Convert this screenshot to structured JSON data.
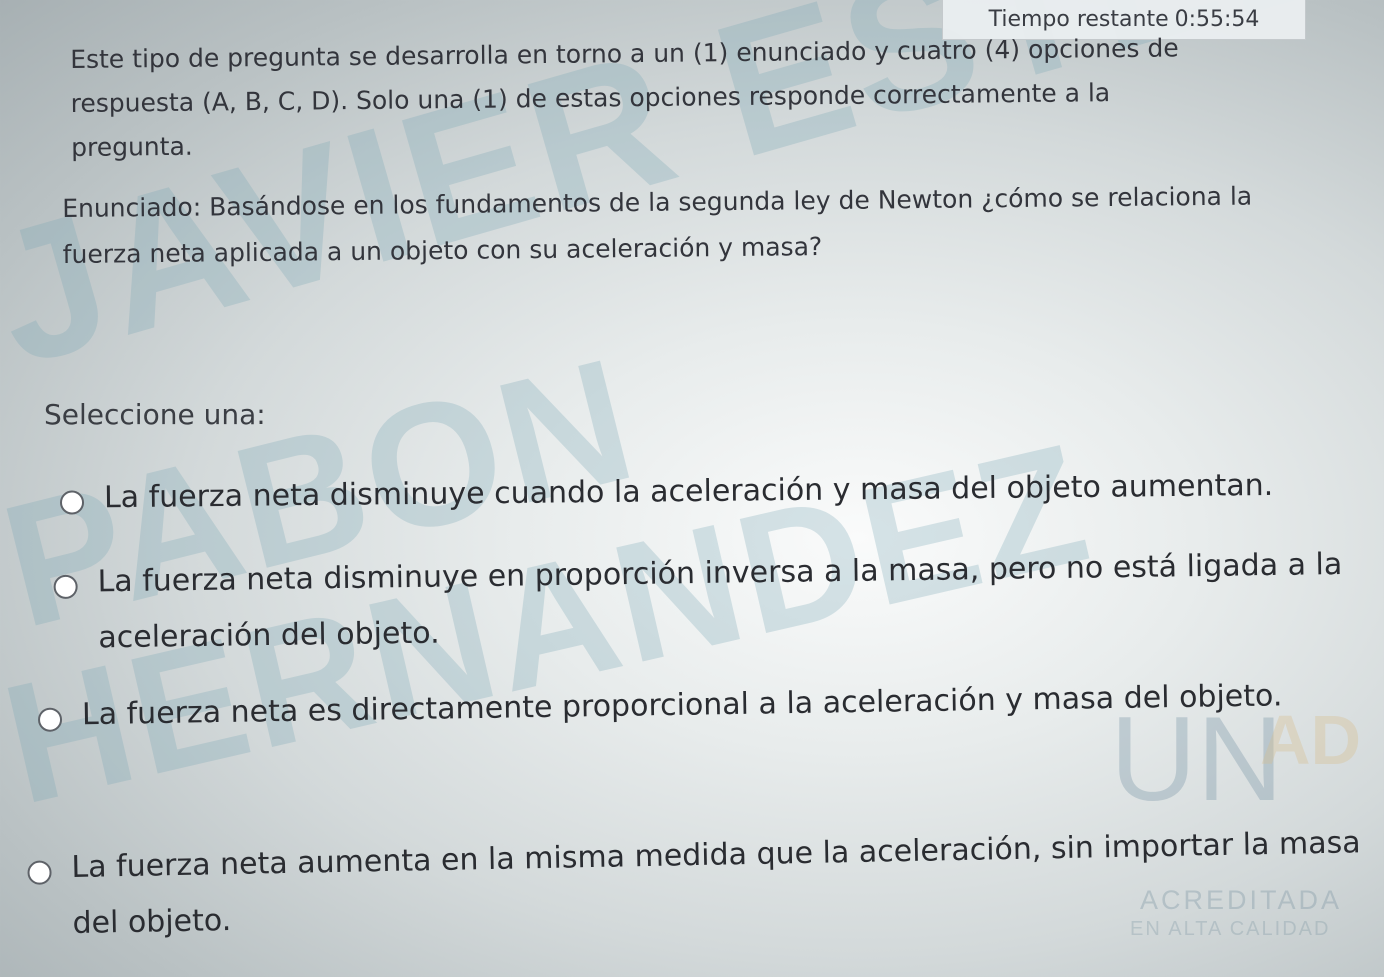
{
  "timer": {
    "label": "Tiempo restante",
    "value": "0:55:54"
  },
  "question": {
    "instructions": "Este tipo de pregunta se desarrolla en torno a un (1) enunciado y cuatro (4) opciones de respuesta (A, B, C, D). Solo una (1) de estas opciones responde correctamente a la pregunta.",
    "statement": "Enunciado: Basándose en los fundamentos de la segunda ley de Newton ¿cómo se relaciona la fuerza neta aplicada a un objeto con su aceleración y masa?",
    "select_label": "Seleccione una:",
    "options": [
      {
        "text": "La fuerza neta disminuye cuando la aceleración y masa del objeto aumentan.",
        "selected": false
      },
      {
        "text": "La fuerza neta disminuye en proporción inversa a la masa, pero no está ligada a la aceleración del objeto.",
        "selected": false
      },
      {
        "text": "La fuerza neta es directamente proporcional a la aceleración y masa del objeto.",
        "selected": false
      },
      {
        "text": "La fuerza neta aumenta en la misma medida que la aceleración, sin importar la masa del objeto.",
        "selected": false
      }
    ]
  },
  "watermark": {
    "line1": "JAVIER ESTEBAN",
    "line2": "PABON",
    "line3": "HERNANDEZ"
  },
  "logo": {
    "un": "UN",
    "ad": "AD",
    "acreditada": "ACREDITADA",
    "alta_calidad": "EN ALTA CALIDAD"
  },
  "colors": {
    "text": "#2b2d33",
    "radio_border": "#5e6268",
    "timer_background": "#eaeef0",
    "watermark": "#78a5b4"
  }
}
